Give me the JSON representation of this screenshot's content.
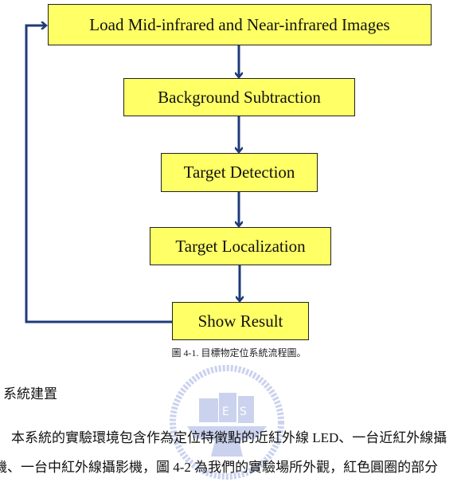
{
  "flowchart": {
    "steps": [
      "Load Mid-infrared and Near-infrared Images",
      "Background Subtraction",
      "Target Detection",
      "Target Localization",
      "Show Result"
    ],
    "colors": {
      "box_fill": "#ffff66",
      "arrow": "#1f3a7a"
    }
  },
  "caption": "圖 4-1. 目標物定位系統流程圖。",
  "section_heading": "系統建置",
  "paragraph_lines": [
    "本系統的實驗環境包含作為定位特徵點的近紅外線 LED、一台近紅外線攝",
    "機、一台中紅外線攝影機，圖 4-2 為我們的實驗場所外觀，紅色圓圈的部分"
  ],
  "watermark": {
    "letters": "ESA",
    "color": "#6b7fd0"
  }
}
